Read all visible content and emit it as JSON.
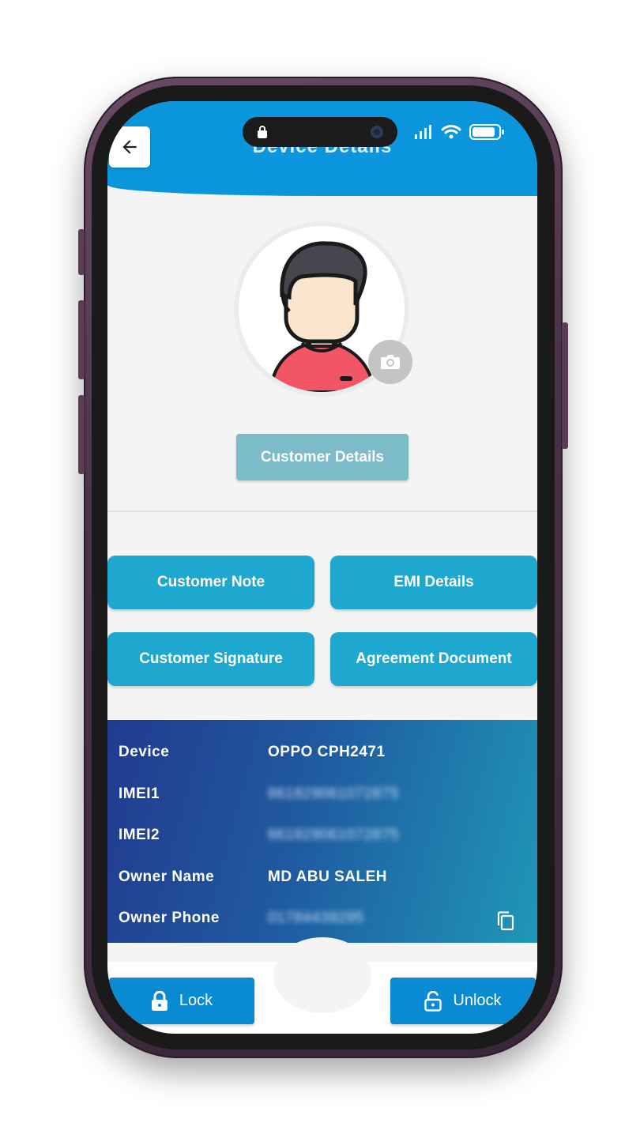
{
  "header": {
    "title": "Device Details",
    "back_icon": "arrow-left-icon"
  },
  "status_bar": {
    "icons": [
      "lock-icon",
      "camera-icon",
      "signal-icon",
      "wifi-icon",
      "battery-icon"
    ]
  },
  "profile": {
    "avatar": "user-avatar",
    "camera_icon": "camera-icon",
    "details_button": "Customer Details"
  },
  "actions": {
    "customer_note": "Customer Note",
    "emi_details": "EMI Details",
    "customer_signature": "Customer Signature",
    "agreement_document": "Agreement Document"
  },
  "device_info": {
    "device_label": "Device",
    "device_value": "OPPO CPH2471",
    "imei1_label": "IMEI1",
    "imei1_value": "861829061072875",
    "imei2_label": "IMEI2",
    "imei2_value": "861829061072875",
    "owner_name_label": "Owner Name",
    "owner_name_value": "MD ABU SALEH",
    "owner_phone_label": "Owner Phone",
    "owner_phone_value": "01784439295",
    "copy_icon": "copy-icon"
  },
  "bottom": {
    "lock_label": "Lock",
    "unlock_label": "Unlock"
  },
  "colors": {
    "header": "#0b95dc",
    "action_button": "#1ea7cf",
    "details_button": "#7bbcc8",
    "bottom_button": "#0a8ad2",
    "card_start": "#223a8e",
    "card_end": "#1f97b8"
  }
}
